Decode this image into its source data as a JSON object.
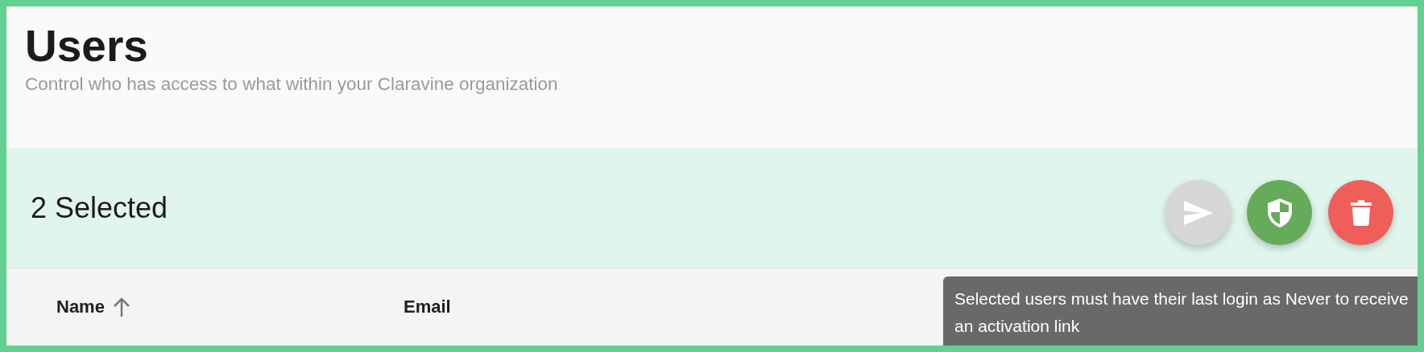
{
  "header": {
    "title": "Users",
    "subtitle": "Control who has access to what within your Claravine organization"
  },
  "selection_bar": {
    "count_label": "2 Selected",
    "actions": [
      {
        "kind": "send",
        "disabled": true
      },
      {
        "kind": "permissions",
        "disabled": false
      },
      {
        "kind": "delete",
        "disabled": false
      }
    ]
  },
  "table": {
    "columns": [
      {
        "label": "Name",
        "sorted": true
      },
      {
        "label": "Email",
        "sorted": false
      }
    ]
  },
  "tooltip": {
    "text": "Selected users must have their last login as Never to receive an activation link"
  }
}
